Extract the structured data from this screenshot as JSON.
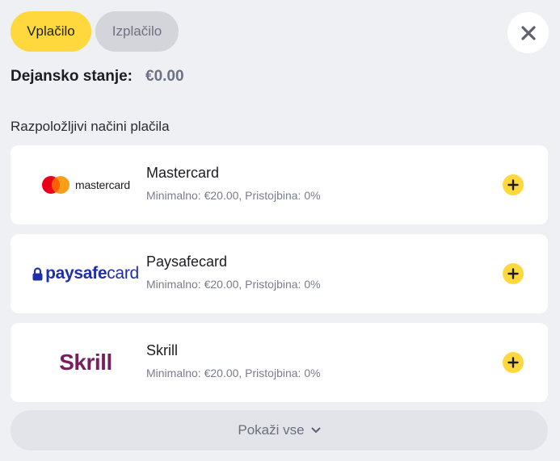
{
  "tabs": [
    {
      "label": "Vplačilo",
      "active": true
    },
    {
      "label": "Izplačilo",
      "active": false
    }
  ],
  "close_icon": "close-icon",
  "balance": {
    "label": "Dejansko stanje:",
    "value": "€0.00"
  },
  "section_title": "Razpoložljivi načini plačila",
  "methods": [
    {
      "name": "Mastercard",
      "details": "Minimalno: €20.00, Pristojbina: 0%",
      "logo_text": "mastercard"
    },
    {
      "name": "Paysafecard",
      "details": "Minimalno: €20.00, Pristojbina: 0%",
      "logo_text_bold": "paysafe",
      "logo_text_light": "card"
    },
    {
      "name": "Skrill",
      "details": "Minimalno: €20.00, Pristojbina: 0%",
      "logo_text": "Skrill"
    }
  ],
  "show_all": {
    "label": "Pokaži vse"
  },
  "colors": {
    "accent": "#ffd83d",
    "background": "#eef0f4",
    "mastercard_red": "#eb001b",
    "mastercard_orange": "#f79e1b",
    "paysafecard_blue": "#1f2fa8",
    "skrill_purple": "#7a1f5e"
  }
}
